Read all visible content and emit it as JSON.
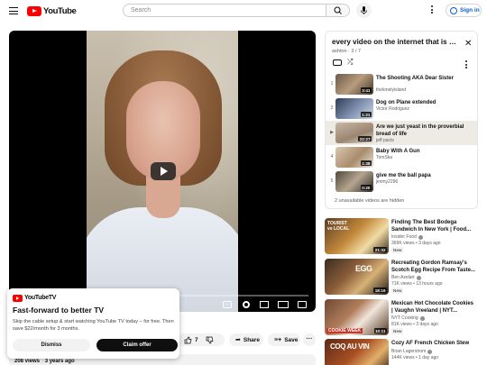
{
  "header": {
    "logo_text": "YouTube",
    "search_placeholder": "Search",
    "signin_label": "Sign in"
  },
  "player": {
    "caption_icon_text": "CC"
  },
  "actions": {
    "like_count": "7",
    "share_label": "Share",
    "save_label": "Save",
    "more_label": "···"
  },
  "description": {
    "views": "208 views",
    "age": "3 years ago"
  },
  "promo": {
    "logo_text": "YouTubeTV",
    "title": "Fast-forward to better TV",
    "body": "Skip the cable setup & start watching YouTube TV today – for free. Then save $22/month for 3 months.",
    "dismiss_label": "Dismiss",
    "claim_label": "Claim offer"
  },
  "playlist": {
    "title": "every video on the internet that is fu...",
    "owner": "ashton",
    "position": "3 / 7",
    "owner_position": "ashton · 3 / 7",
    "close_glyph": "✕",
    "hidden_note": "2 unavailable videos are hidden",
    "items": [
      {
        "index": "1",
        "title": "The Shooting AKA Dear Sister",
        "channel": "thelonelyisland",
        "duration": "3:41"
      },
      {
        "index": "2",
        "title": "Dog on Plane extended",
        "channel": "Victor Rodriguez",
        "duration": "1:21"
      },
      {
        "index": "▶",
        "title": "Are we just yeast in the proverbial bread of life",
        "channel": "jeff pacts",
        "duration": "22:27"
      },
      {
        "index": "4",
        "title": "Baby With A Gun",
        "channel": "TomSka",
        "duration": "1:38"
      },
      {
        "index": "5",
        "title": "give me the ball papa",
        "channel": "jimmy2296",
        "duration": "0:20"
      }
    ]
  },
  "recommendations": [
    {
      "title": "Finding The Best Bodega Sandwich In New York | Food...",
      "channel": "Insider Food",
      "views": "369K views",
      "age": "3 days ago",
      "badge": "New",
      "duration": "21:32",
      "thumb_text": "TOURIST vs LOCAL"
    },
    {
      "title": "Recreating Gordon Ramsay's Scotch Egg Recipe From Taste...",
      "channel": "Ben Azelart",
      "views": "71K views",
      "age": "13 hours ago",
      "badge": "New",
      "duration": "18:16",
      "thumb_text": "EGG"
    },
    {
      "title": "Mexican Hot Chocolate Cookies | Vaughn Vreeland | NYT...",
      "channel": "NYT Cooking",
      "views": "81K views",
      "age": "3 days ago",
      "badge": "New",
      "duration": "10:11",
      "thumb_text": "COOKIE WEEK"
    },
    {
      "title": "Cozy AF French Chicken Stew",
      "channel": "Brian Lagerstrom",
      "views": "144K views",
      "age": "1 day ago",
      "badge": "",
      "duration": "",
      "thumb_text": "COQ AU VIN"
    }
  ]
}
